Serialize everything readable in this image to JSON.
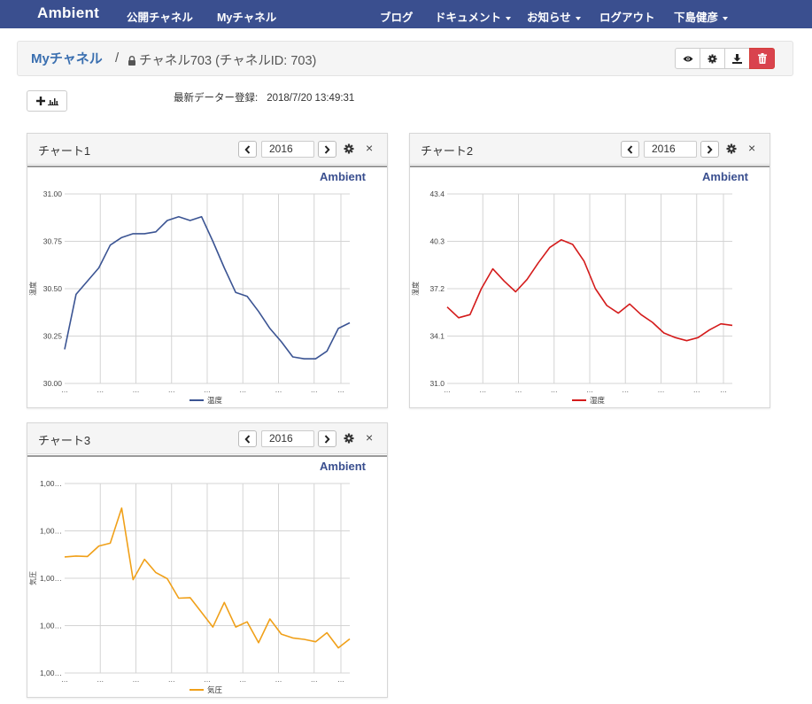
{
  "nav": {
    "brand": "Ambient",
    "left_items": [
      "公開チャネル",
      "Myチャネル"
    ],
    "right_items": [
      {
        "label": "ブログ",
        "dropdown": false
      },
      {
        "label": "ドキュメント",
        "dropdown": true
      },
      {
        "label": "お知らせ",
        "dropdown": true
      },
      {
        "label": "ログアウト",
        "dropdown": false
      },
      {
        "label": "下島健彦",
        "dropdown": true
      }
    ],
    "color": "#3a4f8f"
  },
  "breadcrumb": {
    "link": "Myチャネル",
    "separator": "/",
    "title": "チャネル703 (チャネルID: 703)",
    "actions": [
      "eye-icon",
      "gear-icon",
      "download-icon",
      "trash-icon"
    ]
  },
  "last_update": {
    "label": "最新データー登録:",
    "value": "2018/7/20 13:49:31"
  },
  "charts": [
    {
      "name": "チャート1",
      "year": "2016",
      "logo": "Ambient",
      "ylabel": "温度",
      "legend": "温度",
      "color": "#3b5493"
    },
    {
      "name": "チャート2",
      "year": "2016",
      "logo": "Ambient",
      "ylabel": "湿度",
      "legend": "湿度",
      "color": "#d41b1b"
    },
    {
      "name": "チャート3",
      "year": "2016",
      "logo": "Ambient",
      "ylabel": "気圧",
      "legend": "気圧",
      "color": "#f0a019"
    }
  ],
  "chart_data": [
    {
      "type": "line",
      "title": "",
      "ylabel": "温度",
      "yticks": [
        "31.00",
        "30.75",
        "30.50",
        "30.25",
        "30.00"
      ],
      "ylim": [
        30.0,
        31.0
      ],
      "xtick_labels": [
        "…",
        "…",
        "…",
        "…",
        "…",
        "…",
        "…",
        "…",
        "…"
      ],
      "legend": "top-down",
      "series": [
        {
          "name": "温度",
          "values": [
            30.18,
            30.47,
            30.54,
            30.61,
            30.73,
            30.77,
            30.79,
            30.79,
            30.8,
            30.86,
            30.88,
            30.86,
            30.88,
            30.75,
            30.61,
            30.48,
            30.46,
            30.38,
            30.29,
            30.22,
            30.14,
            30.13,
            30.13,
            30.17,
            30.29,
            30.32
          ]
        }
      ]
    },
    {
      "type": "line",
      "title": "",
      "ylabel": "湿度",
      "yticks": [
        "43.4",
        "40.3",
        "37.2",
        "34.1",
        "31.0"
      ],
      "ylim": [
        31.0,
        43.4
      ],
      "xtick_labels": [
        "…",
        "…",
        "…",
        "…",
        "…",
        "…",
        "…",
        "…",
        "…"
      ],
      "series": [
        {
          "name": "湿度",
          "values": [
            36.0,
            35.3,
            35.5,
            37.2,
            38.5,
            37.7,
            37.0,
            37.8,
            38.9,
            39.9,
            40.4,
            40.1,
            39.0,
            37.2,
            36.1,
            35.6,
            36.2,
            35.5,
            35.0,
            34.3,
            34.0,
            33.8,
            34.0,
            34.5,
            34.9,
            34.8
          ]
        }
      ]
    },
    {
      "type": "line",
      "title": "",
      "ylabel": "気圧",
      "yticks": [
        "1,00…",
        "1,00…",
        "1,00…",
        "1,00…",
        "1,00…"
      ],
      "ylim": [
        0,
        4
      ],
      "xtick_labels": [
        "…",
        "…",
        "…",
        "…",
        "…",
        "…",
        "…",
        "…",
        "…"
      ],
      "series": [
        {
          "name": "気圧",
          "values": [
            2.45,
            2.47,
            2.46,
            2.68,
            2.74,
            3.48,
            1.97,
            2.4,
            2.12,
            1.99,
            1.58,
            1.59,
            1.28,
            0.97,
            1.49,
            0.97,
            1.08,
            0.64,
            1.14,
            0.82,
            0.74,
            0.71,
            0.66,
            0.85,
            0.53,
            0.72
          ]
        }
      ]
    }
  ]
}
